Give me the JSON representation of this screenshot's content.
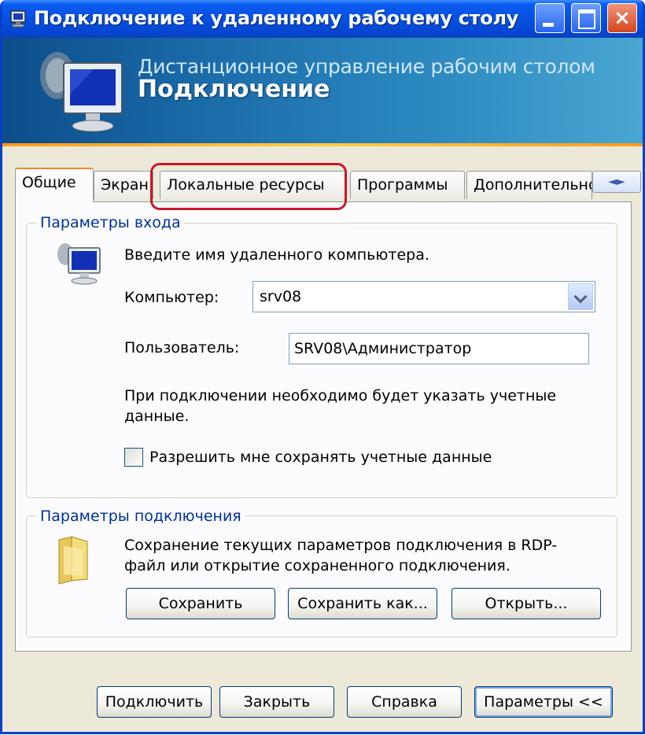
{
  "window": {
    "title": "Подключение к удаленному рабочему столу",
    "controls": {
      "minimize": "minimize-icon",
      "maximize": "maximize-icon",
      "close": "×"
    }
  },
  "banner": {
    "line1": "Дистанционное управление рабочим столом",
    "line2": "Подключение"
  },
  "tabs": [
    {
      "label": "Общие",
      "active": true
    },
    {
      "label": "Экран",
      "active": false
    },
    {
      "label": "Локальные ресурсы",
      "active": false,
      "highlighted": true
    },
    {
      "label": "Программы",
      "active": false
    },
    {
      "label": "Дополнительно",
      "active": false
    }
  ],
  "tab_scroll": "◄►",
  "login": {
    "legend": "Параметры входа",
    "intro": "Введите имя удаленного компьютера.",
    "computer_label": "Компьютер:",
    "computer_value": "srv08",
    "user_label": "Пользователь:",
    "user_value": "SRV08\\Администратор",
    "note": "При подключении необходимо будет указать учетные данные.",
    "save_creds_label": "Разрешить мне сохранять учетные данные",
    "save_creds_checked": false
  },
  "connection": {
    "legend": "Параметры подключения",
    "description": "Сохранение текущих параметров подключения в RDP-файл или открытие сохраненного подключения.",
    "save_label": "Сохранить",
    "save_as_label": "Сохранить как...",
    "open_label": "Открыть..."
  },
  "footer": {
    "connect_label": "Подключить",
    "close_label": "Закрыть",
    "help_label": "Справка",
    "options_label": "Параметры <<"
  },
  "colors": {
    "title_bar": "#0650e0",
    "banner": "#1a6aa8",
    "accent_orange": "#e68b2c",
    "highlight_red": "#c8182a",
    "group_legend": "#00309c"
  }
}
